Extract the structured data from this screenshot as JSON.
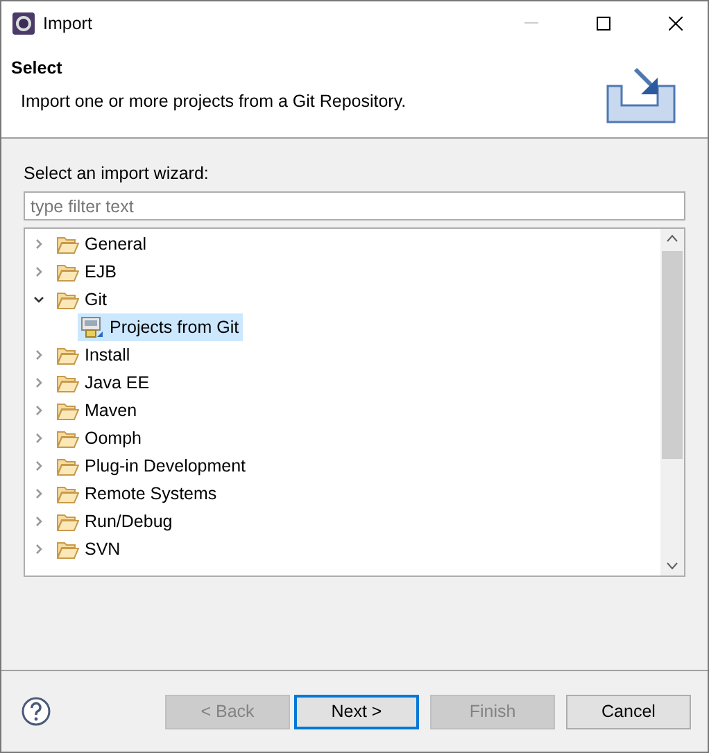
{
  "window": {
    "title": "Import"
  },
  "header": {
    "title": "Select",
    "description": "Import one or more projects from a Git Repository."
  },
  "wizard_label": "Select an import wizard:",
  "filter": {
    "placeholder": "type filter text"
  },
  "tree": [
    {
      "label": "General",
      "expanded": false,
      "selected": false
    },
    {
      "label": "EJB",
      "expanded": false,
      "selected": false
    },
    {
      "label": "Git",
      "expanded": true,
      "selected": false,
      "children": [
        {
          "label": "Projects from Git",
          "selected": true
        }
      ]
    },
    {
      "label": "Install",
      "expanded": false,
      "selected": false
    },
    {
      "label": "Java EE",
      "expanded": false,
      "selected": false
    },
    {
      "label": "Maven",
      "expanded": false,
      "selected": false
    },
    {
      "label": "Oomph",
      "expanded": false,
      "selected": false
    },
    {
      "label": "Plug-in Development",
      "expanded": false,
      "selected": false
    },
    {
      "label": "Remote Systems",
      "expanded": false,
      "selected": false
    },
    {
      "label": "Run/Debug",
      "expanded": false,
      "selected": false
    },
    {
      "label": "SVN",
      "expanded": false,
      "selected": false
    }
  ],
  "buttons": [
    {
      "label": "< Back",
      "disabled": true,
      "default": false
    },
    {
      "label": "Next >",
      "disabled": false,
      "default": true
    },
    {
      "label": "Finish",
      "disabled": true,
      "default": false
    },
    {
      "label": "Cancel",
      "disabled": false,
      "default": false
    }
  ]
}
